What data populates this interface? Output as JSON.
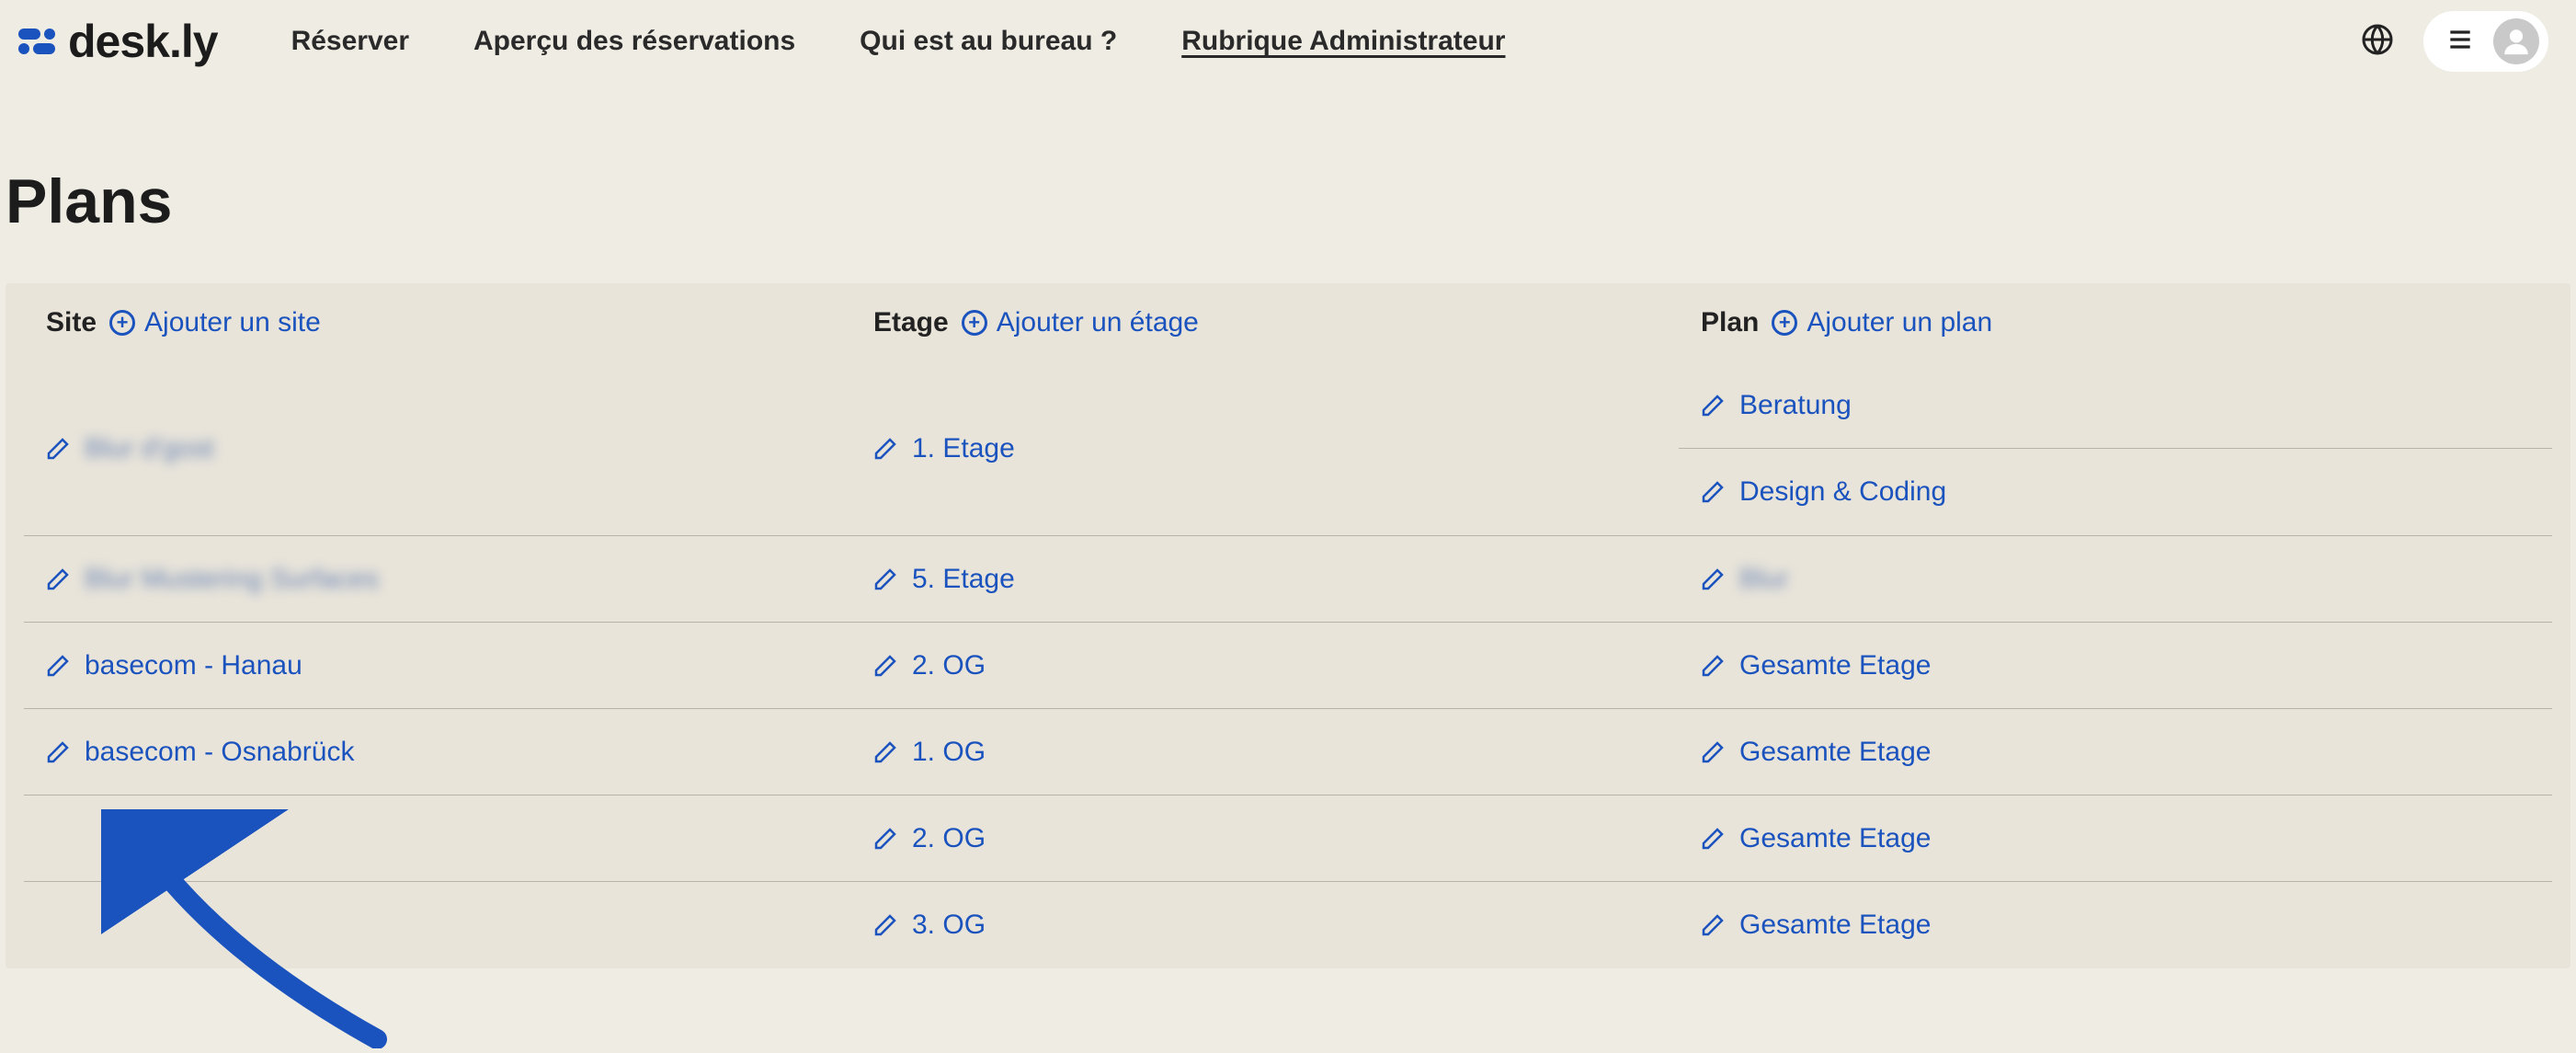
{
  "logo_text": "desk.ly",
  "nav": {
    "reserve": "Réserver",
    "overview": "Aperçu des réservations",
    "who": "Qui est au bureau ?",
    "admin": "Rubrique Administrateur"
  },
  "page_title": "Plans",
  "columns": {
    "site": {
      "label": "Site",
      "add_label": "Ajouter un site"
    },
    "floor": {
      "label": "Etage",
      "add_label": "Ajouter un étage"
    },
    "plan": {
      "label": "Plan",
      "add_label": "Ajouter un plan"
    }
  },
  "rows": [
    {
      "site": {
        "label": "Blur d'gost",
        "blur": true
      },
      "floor": {
        "label": "1. Etage"
      },
      "plans": [
        {
          "label": "Beratung"
        },
        {
          "label": "Design & Coding"
        }
      ]
    },
    {
      "site": {
        "label": "Blur Mustering Surfaces",
        "blur": true
      },
      "floor": {
        "label": "5. Etage"
      },
      "plans": [
        {
          "label": "Blur",
          "blur": true
        }
      ]
    },
    {
      "site": {
        "label": "basecom - Hanau"
      },
      "floor": {
        "label": "2. OG"
      },
      "plans": [
        {
          "label": "Gesamte Etage"
        }
      ]
    },
    {
      "site": {
        "label": "basecom - Osnabrück"
      },
      "floor": {
        "label": "1. OG"
      },
      "plans": [
        {
          "label": "Gesamte Etage"
        }
      ]
    },
    {
      "site": null,
      "floor": {
        "label": "2. OG"
      },
      "plans": [
        {
          "label": "Gesamte Etage"
        }
      ]
    },
    {
      "site": null,
      "floor": {
        "label": "3. OG"
      },
      "plans": [
        {
          "label": "Gesamte Etage"
        }
      ]
    }
  ]
}
